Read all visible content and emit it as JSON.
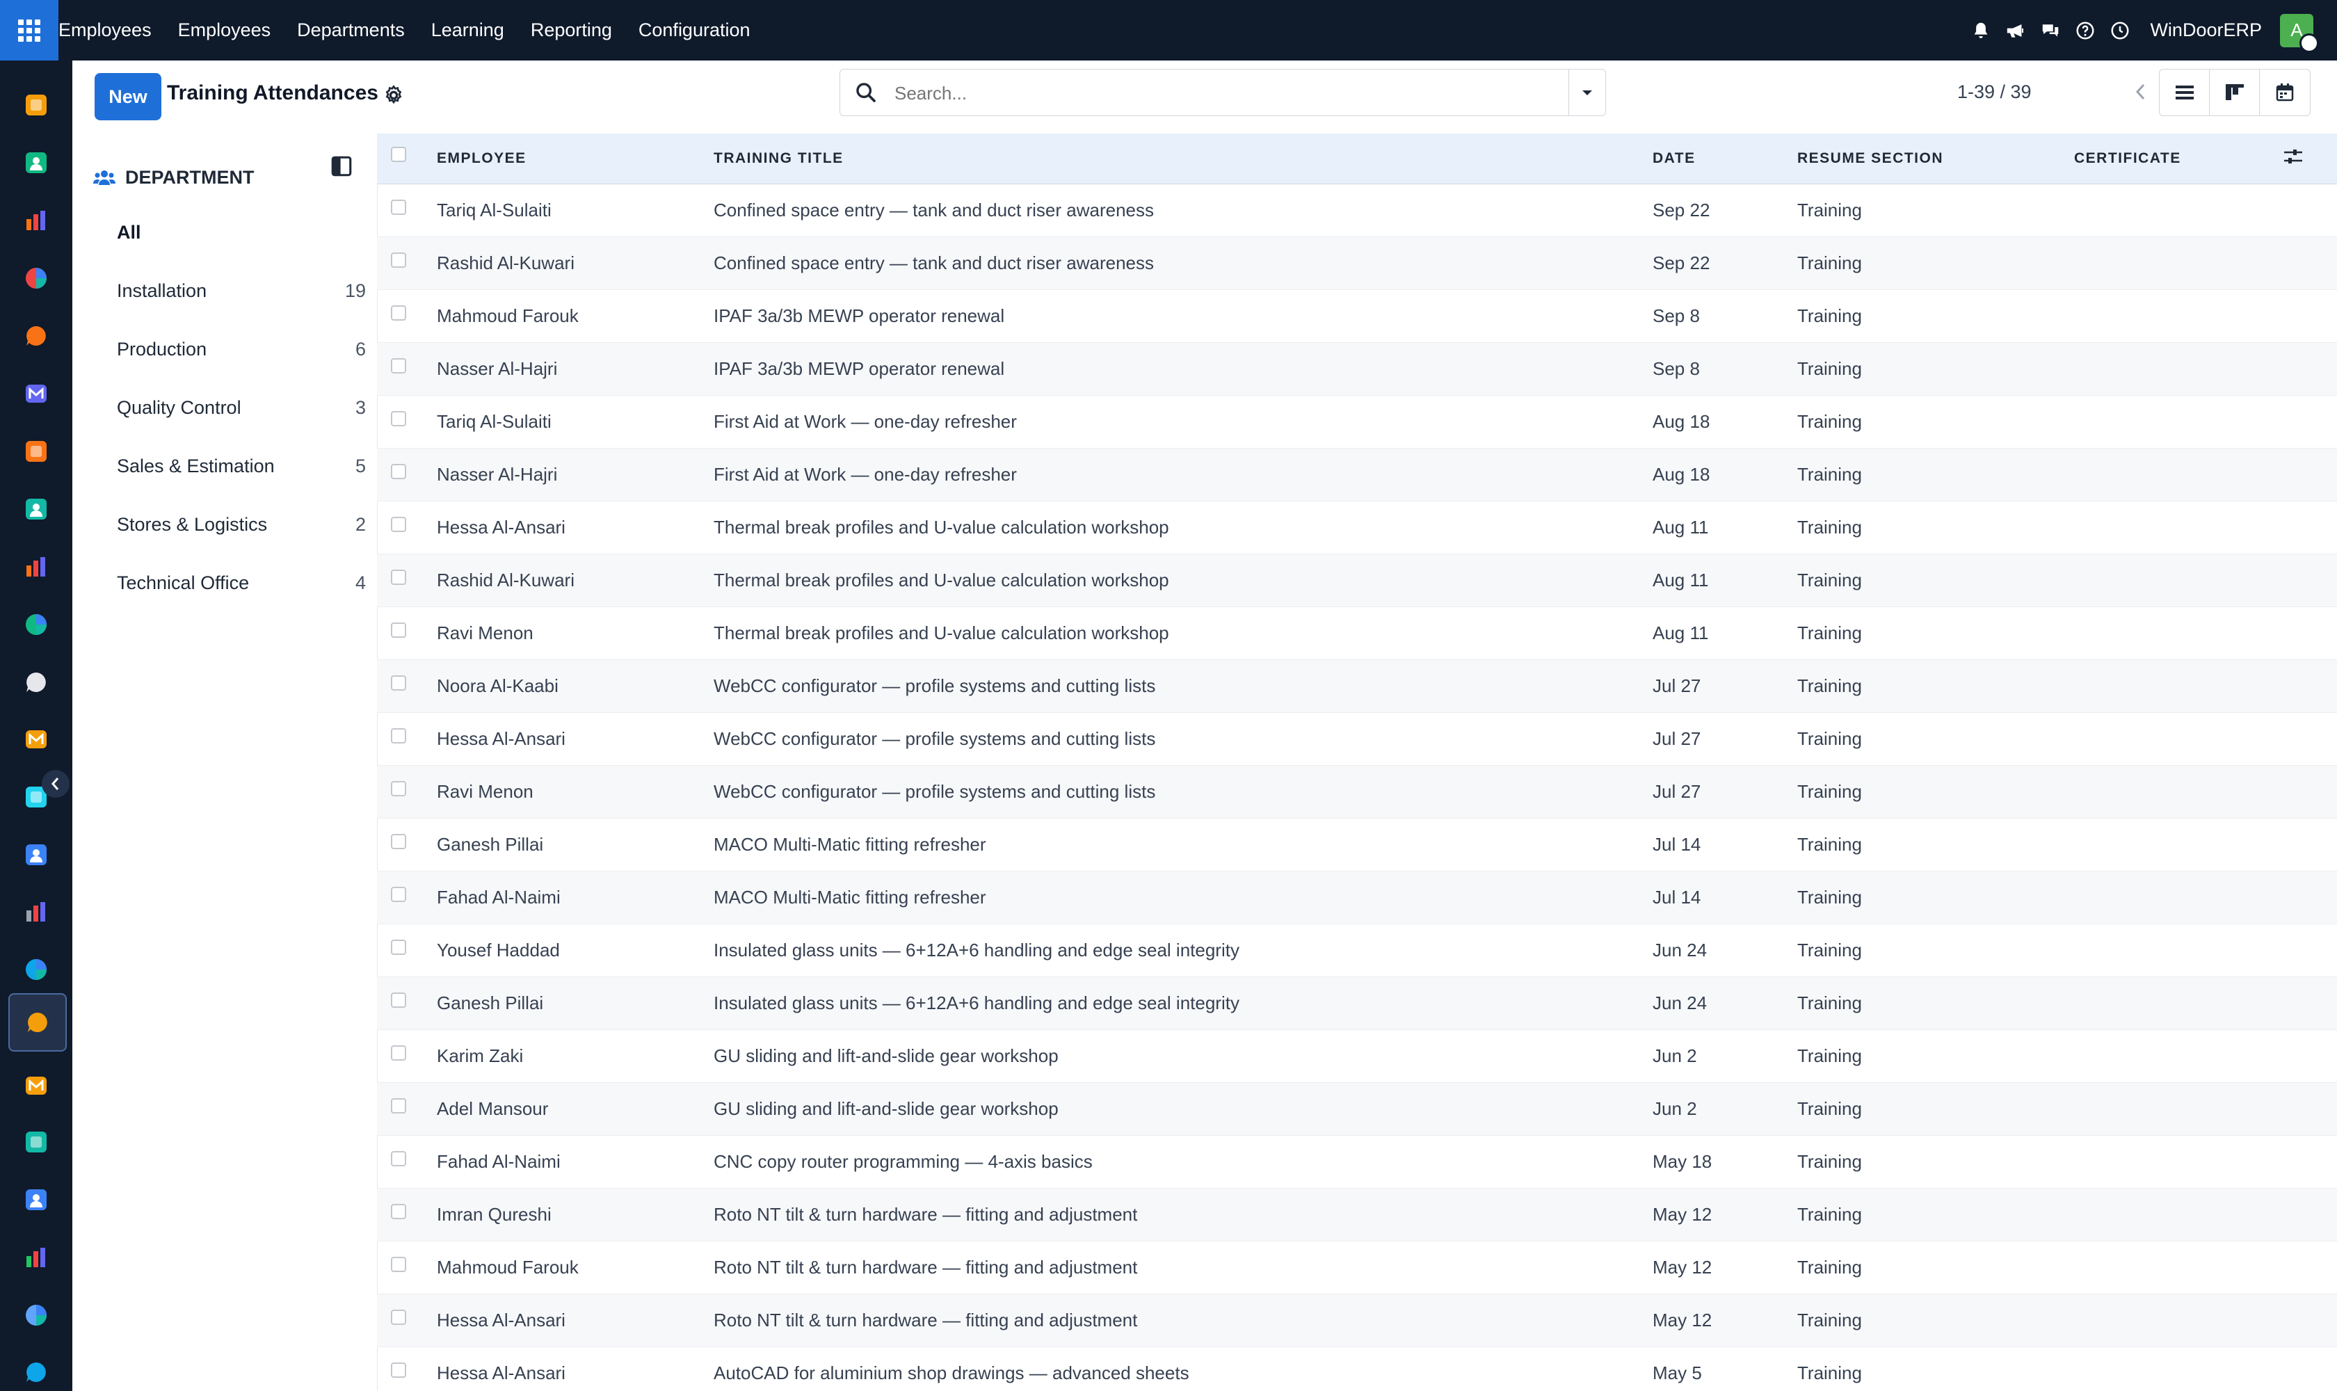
{
  "topbar": {
    "brand": "Employees",
    "menu": [
      "Employees",
      "Departments",
      "Learning",
      "Reporting",
      "Configuration"
    ],
    "company": "WinDoorERP",
    "avatar_letter": "A"
  },
  "rail_apps": [
    {
      "name": "discuss",
      "color": "#f59e0b"
    },
    {
      "name": "contacts",
      "color": "#10b981"
    },
    {
      "name": "reporting",
      "color": "#f97316"
    },
    {
      "name": "dashboards",
      "color": "#ef4444"
    },
    {
      "name": "livechat",
      "color": "#f97316"
    },
    {
      "name": "email-marketing",
      "color": "#6366f1"
    },
    {
      "name": "sms",
      "color": "#f97316"
    },
    {
      "name": "surveys",
      "color": "#14b8a6"
    },
    {
      "name": "sales",
      "color": "#f97316"
    },
    {
      "name": "contacts-2",
      "color": "#10b981"
    },
    {
      "name": "inventory",
      "color": "#e5e7eb"
    },
    {
      "name": "notes",
      "color": "#f59e0b"
    },
    {
      "name": "project",
      "color": "#22d3ee"
    },
    {
      "name": "knowledge",
      "color": "#3b82f6"
    },
    {
      "name": "packages",
      "color": "#9ca3af"
    },
    {
      "name": "invoicing",
      "color": "#0ea5e9"
    },
    {
      "name": "employees",
      "color": "#f59e0b"
    },
    {
      "name": "calendar",
      "color": "#f59e0b"
    },
    {
      "name": "sign",
      "color": "#14b8a6"
    },
    {
      "name": "planning",
      "color": "#3b82f6"
    },
    {
      "name": "whatsapp",
      "color": "#22c55e"
    },
    {
      "name": "timesheets",
      "color": "#60a5fa"
    },
    {
      "name": "website",
      "color": "#0ea5e9"
    }
  ],
  "control": {
    "new_label": "New",
    "title": "Training Attendances",
    "search_placeholder": "Search...",
    "pager": "1-39 / 39"
  },
  "sidepanel": {
    "header": "DEPARTMENT",
    "items": [
      {
        "label": "All",
        "count": ""
      },
      {
        "label": "Installation",
        "count": "19"
      },
      {
        "label": "Production",
        "count": "6"
      },
      {
        "label": "Quality Control",
        "count": "3"
      },
      {
        "label": "Sales & Estimation",
        "count": "5"
      },
      {
        "label": "Stores & Logistics",
        "count": "2"
      },
      {
        "label": "Technical Office",
        "count": "4"
      }
    ]
  },
  "table": {
    "columns": {
      "employee": "EMPLOYEE",
      "title": "TRAINING TITLE",
      "date": "DATE",
      "resume": "RESUME SECTION",
      "certificate": "CERTIFICATE"
    },
    "rows": [
      {
        "employee": "Tariq Al-Sulaiti",
        "title": "Confined space entry — tank and duct riser awareness",
        "date": "Sep 22",
        "resume": "Training",
        "certificate": ""
      },
      {
        "employee": "Rashid Al-Kuwari",
        "title": "Confined space entry — tank and duct riser awareness",
        "date": "Sep 22",
        "resume": "Training",
        "certificate": ""
      },
      {
        "employee": "Mahmoud Farouk",
        "title": "IPAF 3a/3b MEWP operator renewal",
        "date": "Sep 8",
        "resume": "Training",
        "certificate": ""
      },
      {
        "employee": "Nasser Al-Hajri",
        "title": "IPAF 3a/3b MEWP operator renewal",
        "date": "Sep 8",
        "resume": "Training",
        "certificate": ""
      },
      {
        "employee": "Tariq Al-Sulaiti",
        "title": "First Aid at Work — one-day refresher",
        "date": "Aug 18",
        "resume": "Training",
        "certificate": ""
      },
      {
        "employee": "Nasser Al-Hajri",
        "title": "First Aid at Work — one-day refresher",
        "date": "Aug 18",
        "resume": "Training",
        "certificate": ""
      },
      {
        "employee": "Hessa Al-Ansari",
        "title": "Thermal break profiles and U-value calculation workshop",
        "date": "Aug 11",
        "resume": "Training",
        "certificate": ""
      },
      {
        "employee": "Rashid Al-Kuwari",
        "title": "Thermal break profiles and U-value calculation workshop",
        "date": "Aug 11",
        "resume": "Training",
        "certificate": ""
      },
      {
        "employee": "Ravi Menon",
        "title": "Thermal break profiles and U-value calculation workshop",
        "date": "Aug 11",
        "resume": "Training",
        "certificate": ""
      },
      {
        "employee": "Noora Al-Kaabi",
        "title": "WebCC configurator — profile systems and cutting lists",
        "date": "Jul 27",
        "resume": "Training",
        "certificate": ""
      },
      {
        "employee": "Hessa Al-Ansari",
        "title": "WebCC configurator — profile systems and cutting lists",
        "date": "Jul 27",
        "resume": "Training",
        "certificate": ""
      },
      {
        "employee": "Ravi Menon",
        "title": "WebCC configurator — profile systems and cutting lists",
        "date": "Jul 27",
        "resume": "Training",
        "certificate": ""
      },
      {
        "employee": "Ganesh Pillai",
        "title": "MACO Multi-Matic fitting refresher",
        "date": "Jul 14",
        "resume": "Training",
        "certificate": ""
      },
      {
        "employee": "Fahad Al-Naimi",
        "title": "MACO Multi-Matic fitting refresher",
        "date": "Jul 14",
        "resume": "Training",
        "certificate": ""
      },
      {
        "employee": "Yousef Haddad",
        "title": "Insulated glass units — 6+12A+6 handling and edge seal integrity",
        "date": "Jun 24",
        "resume": "Training",
        "certificate": ""
      },
      {
        "employee": "Ganesh Pillai",
        "title": "Insulated glass units — 6+12A+6 handling and edge seal integrity",
        "date": "Jun 24",
        "resume": "Training",
        "certificate": ""
      },
      {
        "employee": "Karim Zaki",
        "title": "GU sliding and lift-and-slide gear workshop",
        "date": "Jun 2",
        "resume": "Training",
        "certificate": ""
      },
      {
        "employee": "Adel Mansour",
        "title": "GU sliding and lift-and-slide gear workshop",
        "date": "Jun 2",
        "resume": "Training",
        "certificate": ""
      },
      {
        "employee": "Fahad Al-Naimi",
        "title": "CNC copy router programming — 4-axis basics",
        "date": "May 18",
        "resume": "Training",
        "certificate": ""
      },
      {
        "employee": "Imran Qureshi",
        "title": "Roto NT tilt & turn hardware — fitting and adjustment",
        "date": "May 12",
        "resume": "Training",
        "certificate": ""
      },
      {
        "employee": "Mahmoud Farouk",
        "title": "Roto NT tilt & turn hardware — fitting and adjustment",
        "date": "May 12",
        "resume": "Training",
        "certificate": ""
      },
      {
        "employee": "Hessa Al-Ansari",
        "title": "Roto NT tilt & turn hardware — fitting and adjustment",
        "date": "May 12",
        "resume": "Training",
        "certificate": ""
      },
      {
        "employee": "Hessa Al-Ansari",
        "title": "AutoCAD for aluminium shop drawings — advanced sheets",
        "date": "May 5",
        "resume": "Training",
        "certificate": ""
      }
    ]
  },
  "colors": {
    "navbar": "#0f1a2b",
    "primary": "#1f6fd9",
    "header_row": "#e8f0fb",
    "avatar": "#4caf50"
  }
}
